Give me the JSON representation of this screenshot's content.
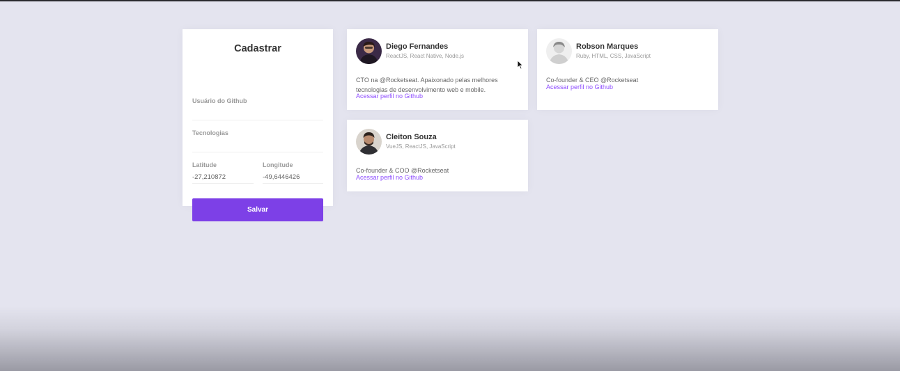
{
  "form": {
    "title": "Cadastrar",
    "github_label": "Usuário do Github",
    "github_value": "",
    "techs_label": "Tecnologias",
    "techs_value": "",
    "latitude_label": "Latitude",
    "latitude_value": "-27,210872",
    "longitude_label": "Longitude",
    "longitude_value": "-49,6446426",
    "save_label": "Salvar"
  },
  "devs": [
    {
      "name": "Diego Fernandes",
      "techs": "ReactJS, React Native, Node.js",
      "bio": "CTO na @Rocketseat. Apaixonado pelas melhores tecnologias de desenvolvimento web e mobile.",
      "link": "Acessar perfil no Github"
    },
    {
      "name": "Robson Marques",
      "techs": "Ruby, HTML, CSS, JavaScript",
      "bio": "Co-founder & CEO @Rocketseat",
      "link": "Acessar perfil no Github"
    },
    {
      "name": "Cleiton Souza",
      "techs": "VueJS, ReactJS, JavaScript",
      "bio": "Co-founder & COO @Rocketseat",
      "link": "Acessar perfil no Github"
    }
  ],
  "colors": {
    "accent": "#7d40e7",
    "link": "#8e4dff",
    "background": "#e4e4ef"
  },
  "icons": {
    "cursor": "mouse-pointer-icon"
  }
}
